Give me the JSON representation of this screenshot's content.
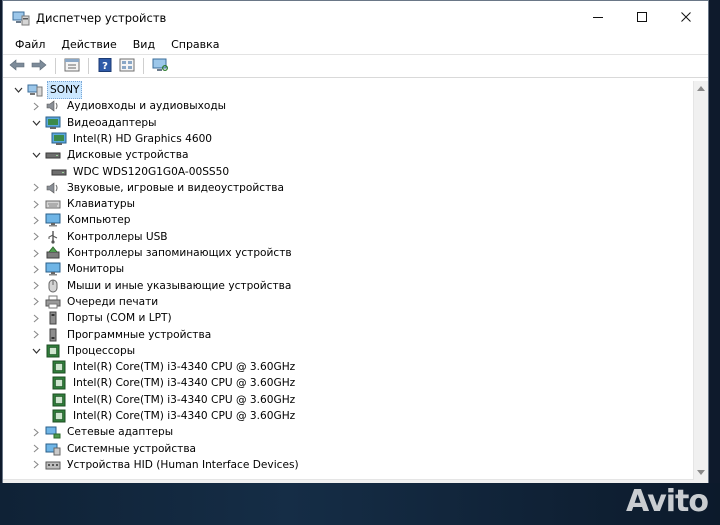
{
  "window": {
    "title": "Диспетчер устройств",
    "icon": "device-manager-icon",
    "controls": [
      "minimize-icon",
      "maximize-icon",
      "close-icon"
    ]
  },
  "menu": {
    "items": [
      {
        "label": "Файл"
      },
      {
        "label": "Действие"
      },
      {
        "label": "Вид"
      },
      {
        "label": "Справка"
      }
    ]
  },
  "toolbar": {
    "buttons": [
      "back-arrow-icon",
      "forward-arrow-icon",
      "properties-icon",
      "help-icon",
      "grid-view-icon",
      "monitor-scan-icon"
    ]
  },
  "tree": {
    "rows": [
      {
        "label": "SONY",
        "level": 0,
        "expanded": true,
        "icon": "computer-icon",
        "selected": true
      },
      {
        "label": "Аудиовходы и аудиовыходы",
        "level": 1,
        "expanded": false,
        "icon": "audio-icon"
      },
      {
        "label": "Видеоадаптеры",
        "level": 1,
        "expanded": true,
        "icon": "display-adapter-icon"
      },
      {
        "label": "Intel(R) HD Graphics 4600",
        "level": 2,
        "icon": "display-adapter-icon"
      },
      {
        "label": "Дисковые устройства",
        "level": 1,
        "expanded": true,
        "icon": "disk-drive-icon"
      },
      {
        "label": "WDC WDS120G1G0A-00SS50",
        "level": 2,
        "icon": "disk-drive-icon"
      },
      {
        "label": "Звуковые, игровые и видеоустройства",
        "level": 1,
        "expanded": false,
        "icon": "speaker-icon"
      },
      {
        "label": "Клавиатуры",
        "level": 1,
        "expanded": false,
        "icon": "keyboard-icon"
      },
      {
        "label": "Компьютер",
        "level": 1,
        "expanded": false,
        "icon": "monitor-icon"
      },
      {
        "label": "Контроллеры USB",
        "level": 1,
        "expanded": false,
        "icon": "usb-icon"
      },
      {
        "label": "Контроллеры запоминающих устройств",
        "level": 1,
        "expanded": false,
        "icon": "storage-controller-icon"
      },
      {
        "label": "Мониторы",
        "level": 1,
        "expanded": false,
        "icon": "monitor-icon"
      },
      {
        "label": "Мыши и иные указывающие устройства",
        "level": 1,
        "expanded": false,
        "icon": "mouse-icon"
      },
      {
        "label": "Очереди печати",
        "level": 1,
        "expanded": false,
        "icon": "printer-icon"
      },
      {
        "label": "Порты (COM и LPT)",
        "level": 1,
        "expanded": false,
        "icon": "port-icon"
      },
      {
        "label": "Программные устройства",
        "level": 1,
        "expanded": false,
        "icon": "software-device-icon"
      },
      {
        "label": "Процессоры",
        "level": 1,
        "expanded": true,
        "icon": "cpu-icon"
      },
      {
        "label": "Intel(R) Core(TM) i3-4340 CPU @ 3.60GHz",
        "level": 2,
        "icon": "cpu-icon"
      },
      {
        "label": "Intel(R) Core(TM) i3-4340 CPU @ 3.60GHz",
        "level": 2,
        "icon": "cpu-icon"
      },
      {
        "label": "Intel(R) Core(TM) i3-4340 CPU @ 3.60GHz",
        "level": 2,
        "icon": "cpu-icon"
      },
      {
        "label": "Intel(R) Core(TM) i3-4340 CPU @ 3.60GHz",
        "level": 2,
        "icon": "cpu-icon"
      },
      {
        "label": "Сетевые адаптеры",
        "level": 1,
        "expanded": false,
        "icon": "network-adapter-icon"
      },
      {
        "label": "Системные устройства",
        "level": 1,
        "expanded": false,
        "icon": "system-device-icon"
      },
      {
        "label": "Устройства HID (Human Interface Devices)",
        "level": 1,
        "expanded": false,
        "icon": "hid-icon"
      }
    ]
  },
  "watermark": {
    "text": "Avito"
  },
  "colors": {
    "selection": "#cce8ff",
    "accent": "#0a7d3e"
  }
}
